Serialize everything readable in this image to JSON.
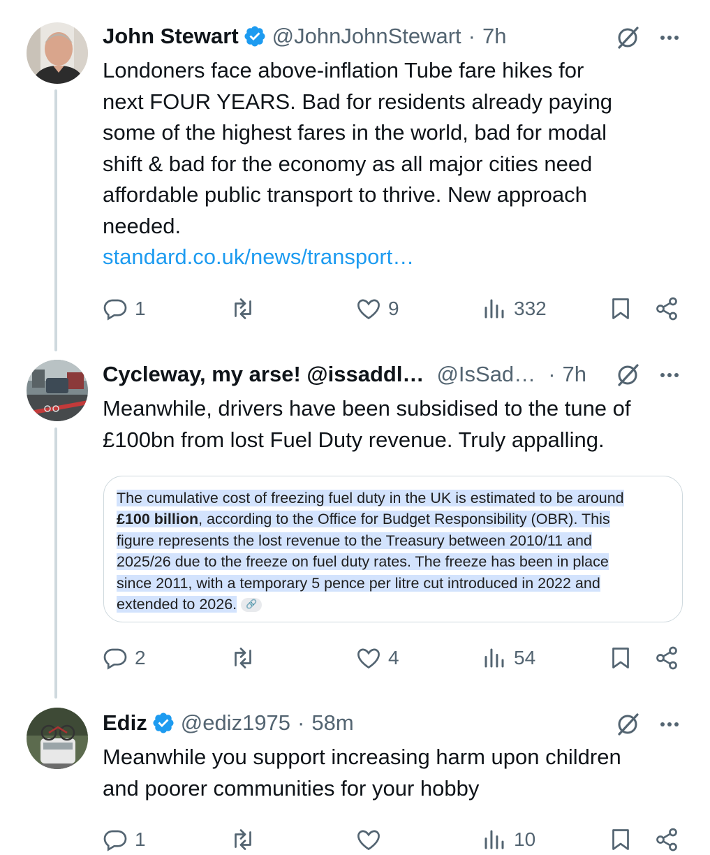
{
  "colors": {
    "text": "#0f1419",
    "secondary": "#536471",
    "link": "#1d9bf0",
    "verified": "#1d9bf0",
    "highlight": "#d3e3fd",
    "thread_line": "#cfd9de"
  },
  "tweets": [
    {
      "name": "John Stewart",
      "handle": "@JohnJohnStewart",
      "separator": "·",
      "time": "7h",
      "verified": true,
      "text_lines": [
        "Londoners face above-inflation Tube fare hikes for",
        "next FOUR YEARS. Bad for residents already paying",
        "some of the highest fares in the world, bad for modal",
        "shift & bad for the economy as all major cities need",
        "affordable public transport to thrive. New approach",
        "needed."
      ],
      "link": "standard.co.uk/news/transport…",
      "replies": "1",
      "retweets": "",
      "likes": "9",
      "views": "332"
    },
    {
      "name": "Cycleway, my arse! @issaddl…",
      "handle": "@IsSad…",
      "separator": "·",
      "time": "7h",
      "verified": false,
      "text_lines": [
        "Meanwhile, drivers have been subsidised to the tune of",
        "£100bn from lost Fuel Duty revenue. Truly appalling."
      ],
      "quote": {
        "line1": "The cumulative cost of freezing fuel duty in the UK is estimated to be around",
        "bold": "£100 billion",
        "line2_rest": ", according to the Office for Budget Responsibility (OBR). This",
        "line3": "figure represents the lost revenue to the Treasury between 2010/11 and",
        "line4": "2025/26 due to the freeze on fuel duty rates. The freeze has been in place",
        "line5": "since 2011, with a temporary 5 pence per litre cut introduced in 2022 and",
        "line6": "extended to 2026."
      },
      "replies": "2",
      "retweets": "",
      "likes": "4",
      "views": "54"
    },
    {
      "name": "Ediz",
      "handle": "@ediz1975",
      "separator": "·",
      "time": "58m",
      "verified": true,
      "text_lines": [
        "Meanwhile you support increasing harm upon children",
        "and poorer communities for your hobby"
      ],
      "replies": "1",
      "views": "10"
    }
  ],
  "icons": [
    "verified-badge-icon",
    "grok-icon",
    "more-icon",
    "reply-icon",
    "retweet-icon",
    "like-icon",
    "views-icon",
    "bookmark-icon",
    "share-icon",
    "link-icon"
  ]
}
